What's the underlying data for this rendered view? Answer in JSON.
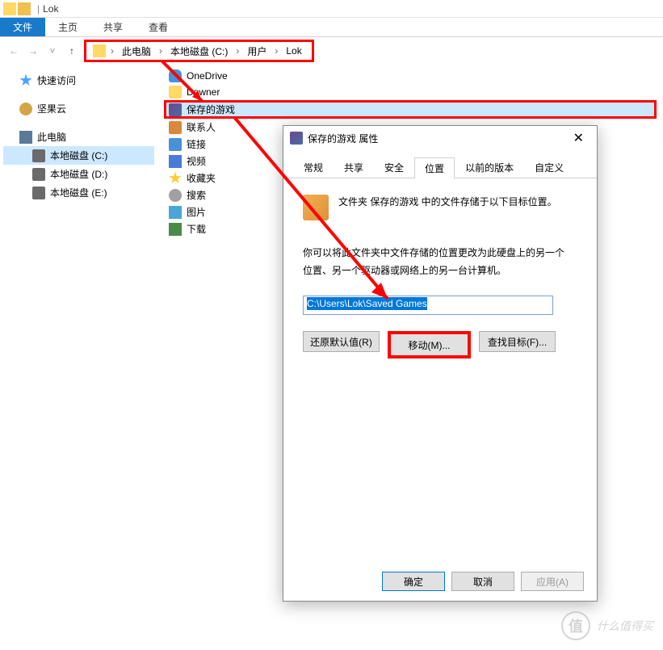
{
  "title": {
    "text": "Lok",
    "separator": "|"
  },
  "ribbon": {
    "file": "文件",
    "home": "主页",
    "share": "共享",
    "view": "查看"
  },
  "breadcrumb": {
    "items": [
      "此电脑",
      "本地磁盘 (C:)",
      "用户",
      "Lok"
    ],
    "separator": "›"
  },
  "sidebar": {
    "quickaccess": "快速访问",
    "nutcloud": "坚果云",
    "thispc": "此电脑",
    "drives": [
      "本地磁盘 (C:)",
      "本地磁盘 (D:)",
      "本地磁盘 (E:)"
    ]
  },
  "files": {
    "onedrive": "OneDrive",
    "downer": "Downer",
    "savedgames": "保存的游戏",
    "contacts": "联系人",
    "links": "链接",
    "videos": "视频",
    "favorites": "收藏夹",
    "searches": "搜索",
    "pictures": "图片",
    "downloads": "下载"
  },
  "dialog": {
    "title": "保存的游戏 属性",
    "tabs": {
      "general": "常规",
      "sharing": "共享",
      "security": "安全",
      "location": "位置",
      "previous": "以前的版本",
      "custom": "自定义"
    },
    "info1": "文件夹 保存的游戏 中的文件存储于以下目标位置。",
    "info2_line1": "你可以将此文件夹中文件存储的位置更改为此硬盘上的另一个",
    "info2_line2": "位置、另一个驱动器或网络上的另一台计算机。",
    "path": "C:\\Users\\Lok\\Saved Games",
    "buttons": {
      "restore": "还原默认值(R)",
      "move": "移动(M)...",
      "find": "查找目标(F)..."
    },
    "footer": {
      "ok": "确定",
      "cancel": "取消",
      "apply": "应用(A)"
    }
  },
  "watermark": {
    "symbol": "值",
    "text": "什么值得买"
  }
}
